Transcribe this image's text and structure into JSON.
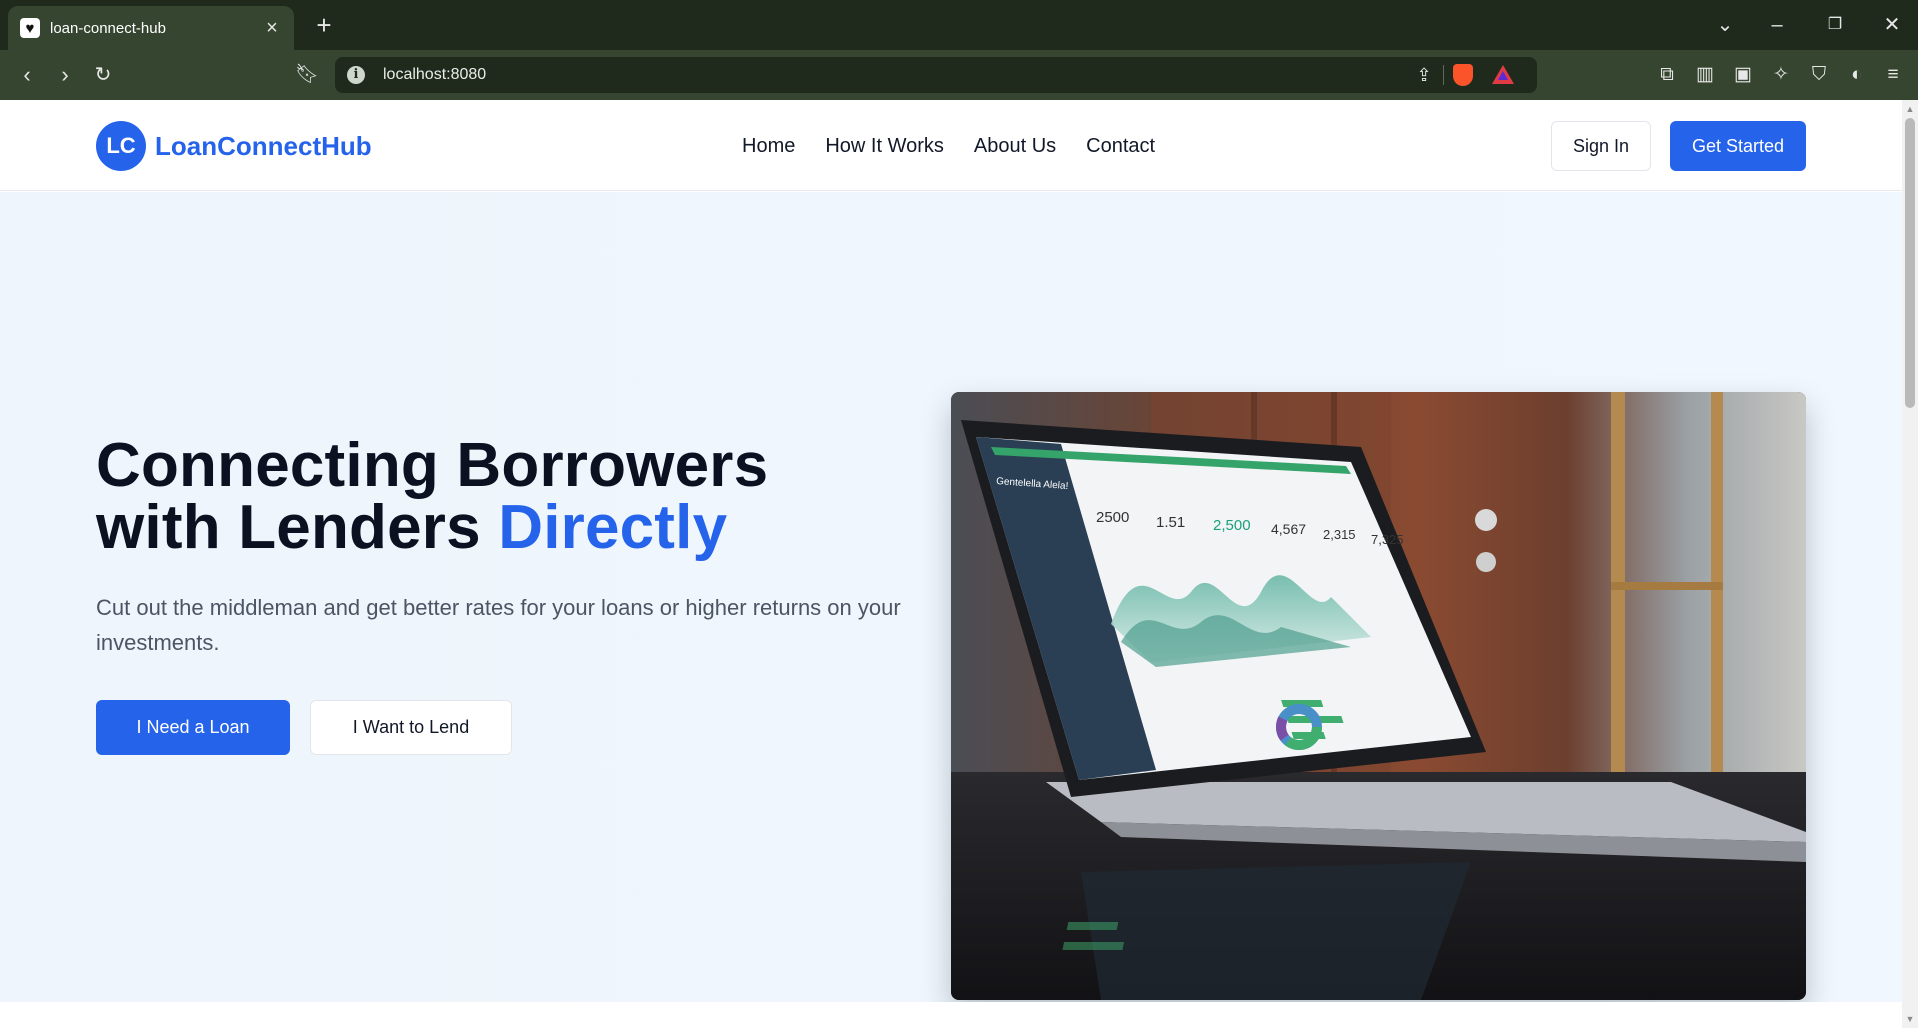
{
  "browser": {
    "tab_title": "loan-connect-hub",
    "url": "localhost:8080"
  },
  "header": {
    "logo_initials": "LC",
    "brand_name": "LoanConnectHub",
    "nav": [
      "Home",
      "How It Works",
      "About Us",
      "Contact"
    ],
    "sign_in_label": "Sign In",
    "get_started_label": "Get Started"
  },
  "hero": {
    "title_line1": "Connecting Borrowers",
    "title_line2": "with Lenders ",
    "title_accent": "Directly",
    "subtitle": "Cut out the middleman and get better rates for your loans or higher returns on your investments.",
    "primary_cta": "I Need a Loan",
    "secondary_cta": "I Want to Lend"
  },
  "laptop_screen": {
    "sidebar_title": "Gentelella Alela!",
    "stats": [
      "2500",
      "1.51",
      "2,500",
      "4,567",
      "2,315",
      "7,325"
    ]
  },
  "colors": {
    "brand": "#2563eb",
    "chrome_dark": "#1f2a1d",
    "chrome_toolbar": "#35452f",
    "hero_bg": "#eef5fc"
  }
}
